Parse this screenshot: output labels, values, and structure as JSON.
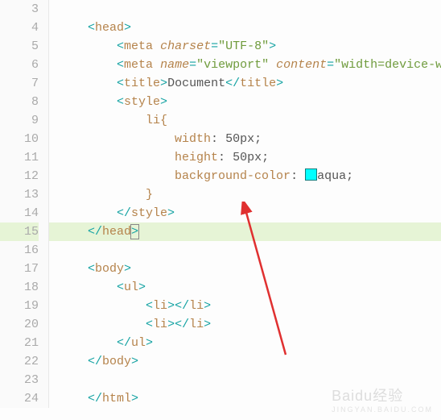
{
  "gutter": {
    "start": 3,
    "end": 24
  },
  "code": {
    "l3": "",
    "l4": {
      "pre": "    ",
      "open": "<",
      "name": "head",
      "close": ">"
    },
    "l5": {
      "pre": "        ",
      "tag": "meta",
      "attr": "charset",
      "val": "\"UTF-8\""
    },
    "l6": {
      "pre": "        ",
      "tag": "meta",
      "attr1": "name",
      "val1": "\"viewport\"",
      "attr2": "content",
      "val2": "\"width=device-wi"
    },
    "l7": {
      "pre": "        ",
      "open": "title",
      "text": "Document",
      "close": "title"
    },
    "l8": {
      "pre": "        ",
      "name": "style"
    },
    "l9": {
      "pre": "            ",
      "sel": "li{"
    },
    "l10": {
      "pre": "                ",
      "prop": "width",
      "val": "50px"
    },
    "l11": {
      "pre": "                ",
      "prop": "height",
      "val": "50px"
    },
    "l12": {
      "pre": "                ",
      "prop": "background-color",
      "val": "aqua"
    },
    "l13": {
      "pre": "            ",
      "text": "}"
    },
    "l14": {
      "pre": "        ",
      "name": "style"
    },
    "l15": {
      "pre": "    ",
      "name": "head"
    },
    "l16": "",
    "l17": {
      "pre": "    ",
      "name": "body"
    },
    "l18": {
      "pre": "        ",
      "name": "ul"
    },
    "l19": {
      "pre": "            ",
      "name": "li"
    },
    "l20": {
      "pre": "            ",
      "name": "li"
    },
    "l21": {
      "pre": "        ",
      "name": "ul"
    },
    "l22": {
      "pre": "    ",
      "name": "body"
    },
    "l23": "",
    "l24": {
      "pre": "    ",
      "name": "html"
    }
  },
  "watermark": {
    "main": "Baidu经验",
    "sub": "JINGYAN.BAIDU.COM"
  }
}
